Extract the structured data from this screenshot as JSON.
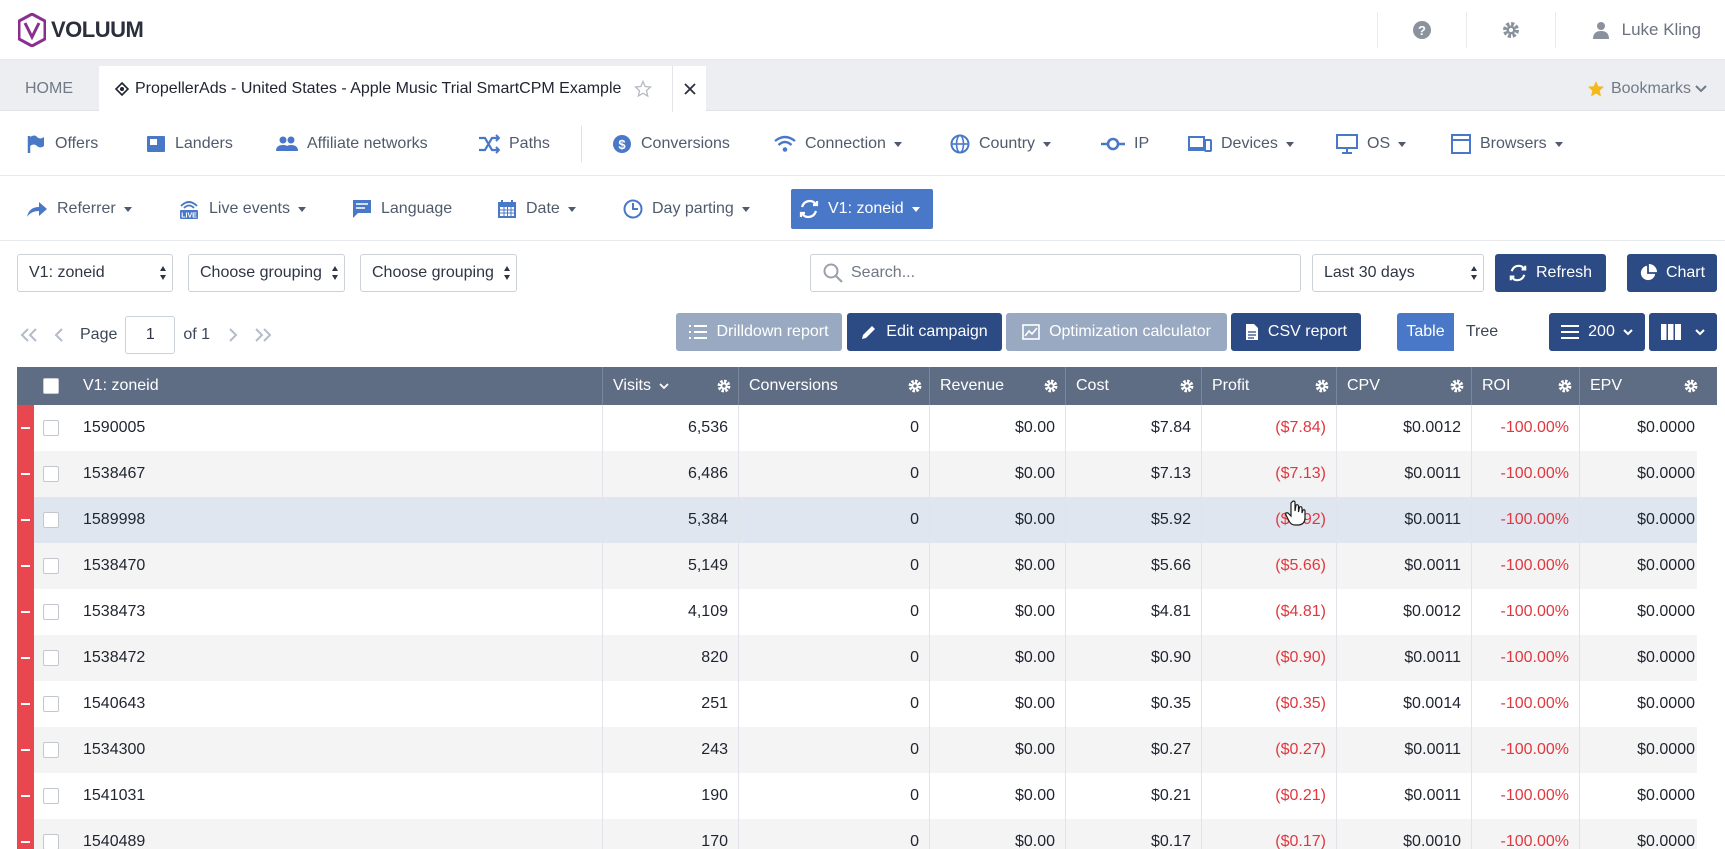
{
  "header": {
    "brand": "VOLUUM",
    "user_name": "Luke Kling",
    "icons": {
      "help": "help-circle-icon",
      "settings": "gear-icon",
      "user": "user-icon"
    }
  },
  "tabs": {
    "home_label": "HOME",
    "active_label": "PropellerAds - United States - Apple Music Trial SmartCPM Example",
    "bookmarks_label": "Bookmarks"
  },
  "nav_row1": [
    {
      "label": "Offers",
      "icon": "flag-icon"
    },
    {
      "label": "Landers",
      "icon": "lander-icon"
    },
    {
      "label": "Affiliate networks",
      "icon": "people-icon"
    },
    {
      "label": "Paths",
      "icon": "paths-icon"
    },
    {
      "label": "Conversions",
      "icon": "conversions-icon"
    },
    {
      "label": "Connection",
      "icon": "wifi-icon"
    },
    {
      "label": "Country",
      "icon": "globe-icon"
    },
    {
      "label": "IP",
      "icon": "ip-icon"
    },
    {
      "label": "Devices",
      "icon": "devices-icon"
    },
    {
      "label": "OS",
      "icon": "monitor-icon"
    },
    {
      "label": "Browsers",
      "icon": "browser-icon"
    }
  ],
  "nav_row2": [
    {
      "label": "Referrer",
      "icon": "share-arrow-icon"
    },
    {
      "label": "Live events",
      "icon": "live-icon"
    },
    {
      "label": "Language",
      "icon": "chat-icon"
    },
    {
      "label": "Date",
      "icon": "calendar-icon"
    },
    {
      "label": "Day parting",
      "icon": "clock-icon"
    },
    {
      "label": "V1: zoneid",
      "icon": "refresh-icon"
    }
  ],
  "controls": {
    "grouping1": "V1: zoneid",
    "grouping2": "Choose grouping",
    "grouping3": "Choose grouping",
    "search_placeholder": "Search...",
    "date_range": "Last 30 days",
    "refresh_label": "Refresh",
    "chart_label": "Chart"
  },
  "pager": {
    "page_label": "Page",
    "page": "1",
    "of_label": "of 1"
  },
  "toolbar": {
    "drilldown": "Drilldown report",
    "edit": "Edit campaign",
    "optimization": "Optimization calculator",
    "csv": "CSV report",
    "table": "Table",
    "tree": "Tree",
    "rows": "200"
  },
  "table": {
    "columns": [
      "V1: zoneid",
      "Visits",
      "Conversions",
      "Revenue",
      "Cost",
      "Profit",
      "CPV",
      "ROI",
      "EPV"
    ],
    "rows": [
      [
        "1590005",
        "6,536",
        "0",
        "$0.00",
        "$7.84",
        "($7.84)",
        "$0.0012",
        "-100.00%",
        "$0.0000"
      ],
      [
        "1538467",
        "6,486",
        "0",
        "$0.00",
        "$7.13",
        "($7.13)",
        "$0.0011",
        "-100.00%",
        "$0.0000"
      ],
      [
        "1589998",
        "5,384",
        "0",
        "$0.00",
        "$5.92",
        "($5.92)",
        "$0.0011",
        "-100.00%",
        "$0.0000"
      ],
      [
        "1538470",
        "5,149",
        "0",
        "$0.00",
        "$5.66",
        "($5.66)",
        "$0.0011",
        "-100.00%",
        "$0.0000"
      ],
      [
        "1538473",
        "4,109",
        "0",
        "$0.00",
        "$4.81",
        "($4.81)",
        "$0.0012",
        "-100.00%",
        "$0.0000"
      ],
      [
        "1538472",
        "820",
        "0",
        "$0.00",
        "$0.90",
        "($0.90)",
        "$0.0011",
        "-100.00%",
        "$0.0000"
      ],
      [
        "1540643",
        "251",
        "0",
        "$0.00",
        "$0.35",
        "($0.35)",
        "$0.0014",
        "-100.00%",
        "$0.0000"
      ],
      [
        "1534300",
        "243",
        "0",
        "$0.00",
        "$0.27",
        "($0.27)",
        "$0.0011",
        "-100.00%",
        "$0.0000"
      ],
      [
        "1541031",
        "190",
        "0",
        "$0.00",
        "$0.21",
        "($0.21)",
        "$0.0011",
        "-100.00%",
        "$0.0000"
      ],
      [
        "1540489",
        "170",
        "0",
        "$0.00",
        "$0.17",
        "($0.17)",
        "$0.0010",
        "-100.00%",
        "$0.0000"
      ]
    ]
  },
  "colors": {
    "accent": "#4a78c8",
    "dark_button": "#2c4a83",
    "negative": "#e0383f",
    "stripe": "#e8474f"
  }
}
